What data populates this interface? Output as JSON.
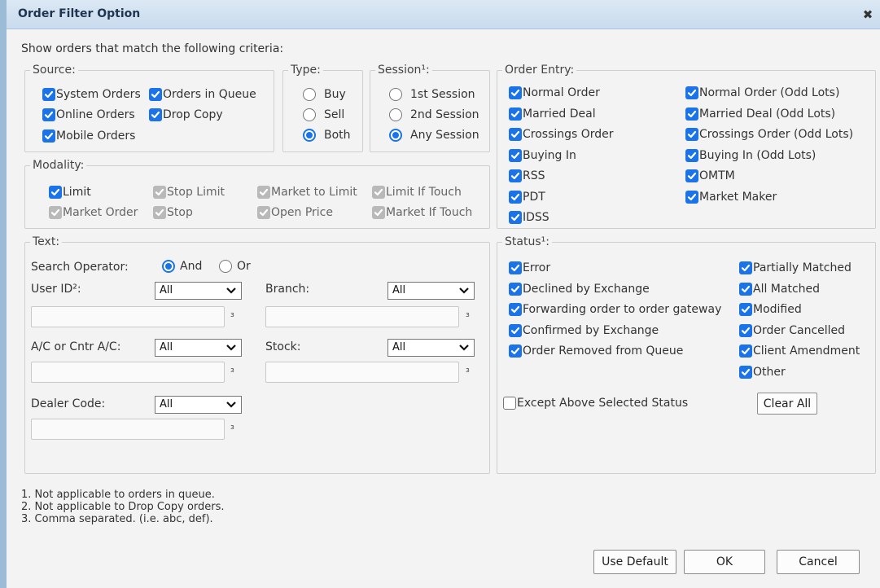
{
  "window": {
    "title": "Order Filter Option",
    "close_glyph": "✖"
  },
  "intro": "Show orders that match the following criteria:",
  "source": {
    "legend": "Source:",
    "items": [
      {
        "label": "System Orders",
        "checked": true
      },
      {
        "label": "Orders in Queue",
        "checked": true
      },
      {
        "label": "Online Orders",
        "checked": true
      },
      {
        "label": "Drop Copy",
        "checked": true
      },
      {
        "label": "Mobile Orders",
        "checked": true
      }
    ]
  },
  "type": {
    "legend": "Type:",
    "options": [
      {
        "label": "Buy",
        "selected": false
      },
      {
        "label": "Sell",
        "selected": false
      },
      {
        "label": "Both",
        "selected": true
      }
    ]
  },
  "session": {
    "legend": "Session¹:",
    "options": [
      {
        "label": "1st Session",
        "selected": false
      },
      {
        "label": "2nd Session",
        "selected": false
      },
      {
        "label": "Any Session",
        "selected": true
      }
    ]
  },
  "modality": {
    "legend": "Modality:",
    "items": [
      {
        "label": "Limit",
        "checked": true,
        "enabled": true
      },
      {
        "label": "Stop Limit",
        "checked": true,
        "enabled": false
      },
      {
        "label": "Market to Limit",
        "checked": true,
        "enabled": false
      },
      {
        "label": "Limit If Touch",
        "checked": true,
        "enabled": false
      },
      {
        "label": "Market Order",
        "checked": true,
        "enabled": false
      },
      {
        "label": "Stop",
        "checked": true,
        "enabled": false
      },
      {
        "label": "Open Price",
        "checked": true,
        "enabled": false
      },
      {
        "label": "Market If Touch",
        "checked": true,
        "enabled": false
      }
    ]
  },
  "order_entry": {
    "legend": "Order Entry:",
    "left": [
      {
        "label": "Normal Order",
        "checked": true
      },
      {
        "label": "Married Deal",
        "checked": true
      },
      {
        "label": "Crossings Order",
        "checked": true
      },
      {
        "label": "Buying In",
        "checked": true
      },
      {
        "label": "RSS",
        "checked": true
      },
      {
        "label": "PDT",
        "checked": true
      },
      {
        "label": "IDSS",
        "checked": true
      }
    ],
    "right": [
      {
        "label": "Normal Order (Odd Lots)",
        "checked": true
      },
      {
        "label": "Married Deal (Odd Lots)",
        "checked": true
      },
      {
        "label": "Crossings Order (Odd Lots)",
        "checked": true
      },
      {
        "label": "Buying In (Odd Lots)",
        "checked": true
      },
      {
        "label": "OMTM",
        "checked": true
      },
      {
        "label": "Market Maker",
        "checked": true
      }
    ]
  },
  "text": {
    "legend": "Text:",
    "search_operator_label": "Search Operator:",
    "operators": [
      {
        "label": "And",
        "selected": true
      },
      {
        "label": "Or",
        "selected": false
      }
    ],
    "user_id_label": "User ID²:",
    "user_id_select": "All",
    "branch_label": "Branch:",
    "branch_select": "All",
    "ac_label": "A/C or Cntr A/C:",
    "ac_select": "All",
    "stock_label": "Stock:",
    "stock_select": "All",
    "dealer_label": "Dealer Code:",
    "dealer_select": "All",
    "superscript": "з"
  },
  "status": {
    "legend": "Status¹:",
    "left": [
      {
        "label": "Error",
        "checked": true
      },
      {
        "label": "Declined by Exchange",
        "checked": true
      },
      {
        "label": "Forwarding order to order gateway",
        "checked": true
      },
      {
        "label": "Confirmed by Exchange",
        "checked": true
      },
      {
        "label": "Order Removed from Queue",
        "checked": true
      }
    ],
    "right": [
      {
        "label": "Partially Matched",
        "checked": true
      },
      {
        "label": "All Matched",
        "checked": true
      },
      {
        "label": "Modified",
        "checked": true
      },
      {
        "label": "Order Cancelled",
        "checked": true
      },
      {
        "label": "Client Amendment",
        "checked": true
      },
      {
        "label": "Other",
        "checked": true
      }
    ],
    "except_label": "Except Above Selected Status",
    "except_checked": false,
    "clear_all": "Clear All"
  },
  "notes": [
    "1. Not applicable to orders in queue.",
    "2. Not applicable to Drop Copy orders.",
    "3. Comma separated. (i.e. abc, def)."
  ],
  "buttons": {
    "use_default": "Use Default",
    "ok": "OK",
    "cancel": "Cancel"
  }
}
